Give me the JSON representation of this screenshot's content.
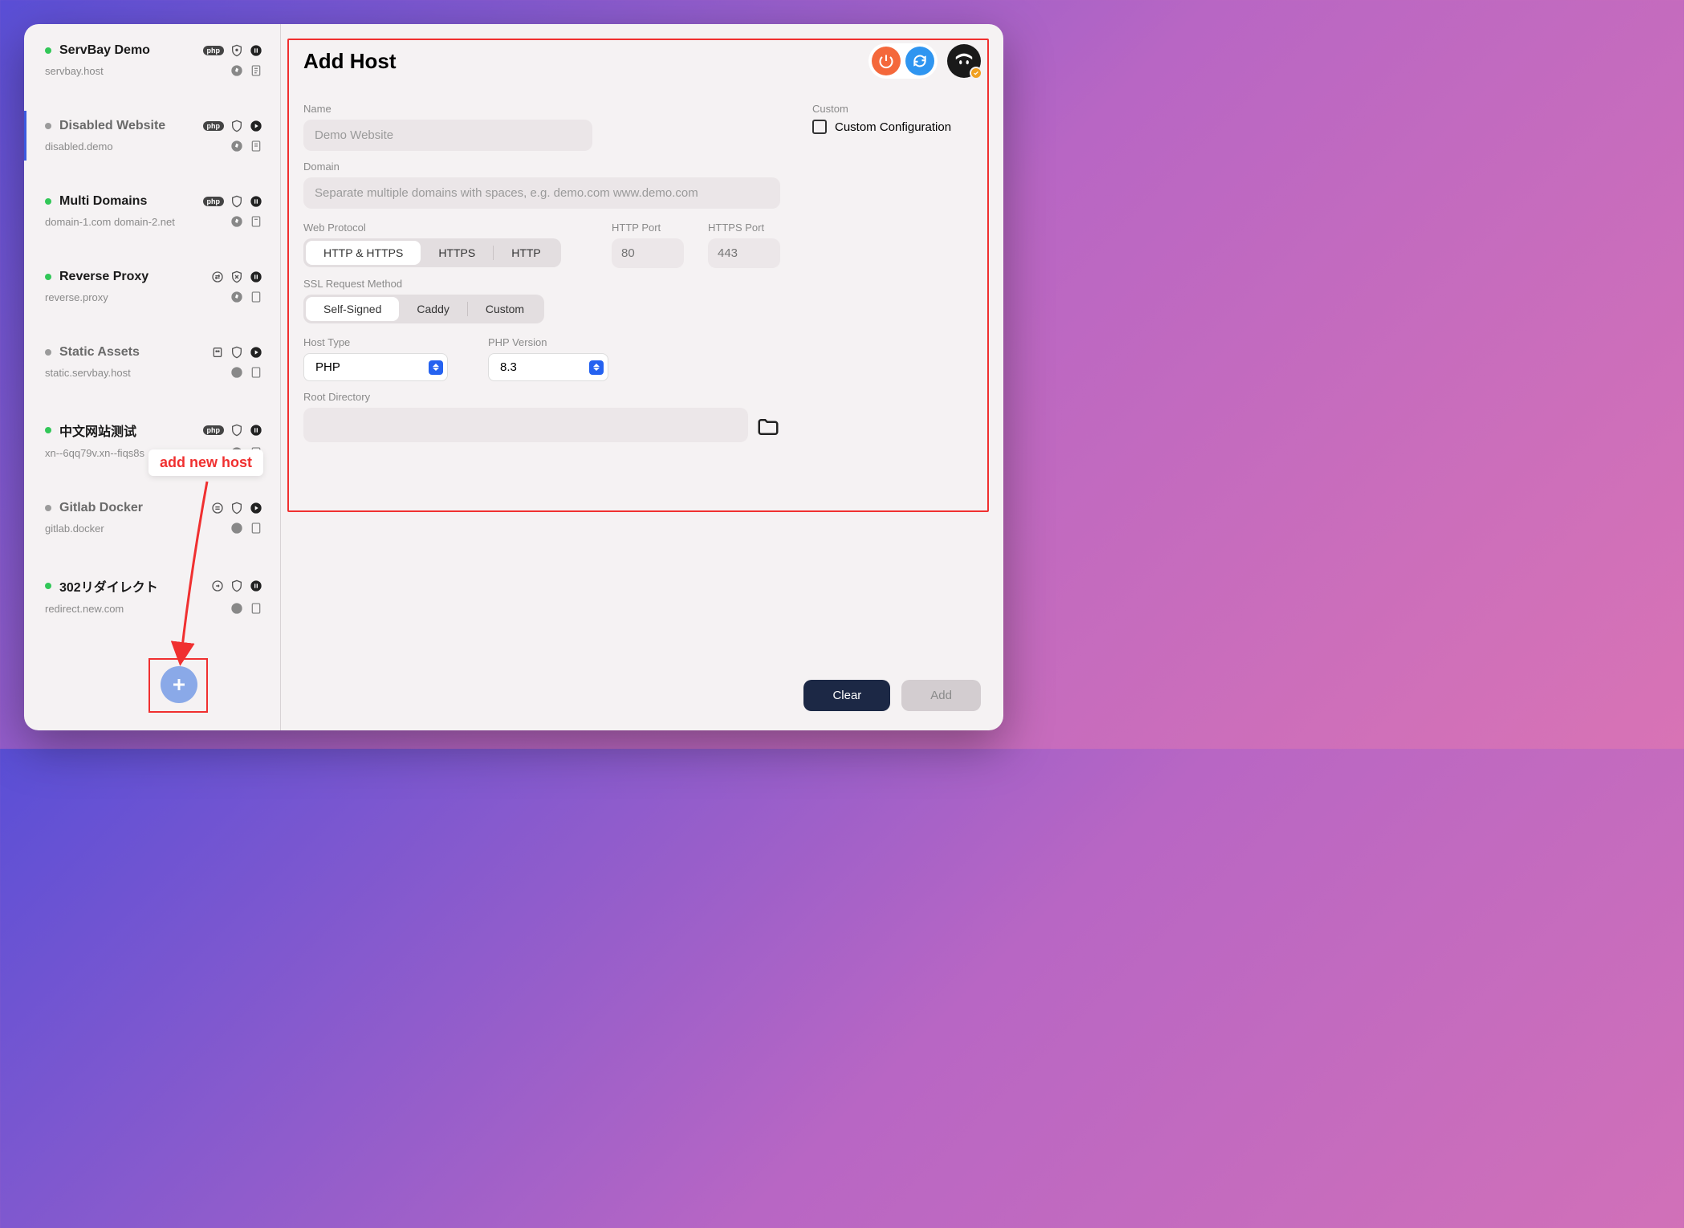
{
  "sidebar": {
    "sites": [
      {
        "name": "ServBay Demo",
        "domain": "servbay.host",
        "status": "green",
        "badge": "php",
        "icon1": "shield-lock",
        "icon2": "pause",
        "icon3": "compass",
        "icon4": "log"
      },
      {
        "name": "Disabled Website",
        "domain": "disabled.demo",
        "status": "grey",
        "badge": "php",
        "icon1": "shield",
        "icon2": "play",
        "icon3": "compass",
        "icon4": "log",
        "selected": true
      },
      {
        "name": "Multi Domains",
        "domain": "domain-1.com domain-2.net",
        "status": "green",
        "badge": "php",
        "icon1": "shield",
        "icon2": "pause",
        "icon3": "compass",
        "icon4": "log"
      },
      {
        "name": "Reverse Proxy",
        "domain": "reverse.proxy",
        "status": "green",
        "badge": "swap",
        "icon1": "shield-x",
        "icon2": "pause",
        "icon3": "compass",
        "icon4": "log"
      },
      {
        "name": "Static Assets",
        "domain": "static.servbay.host",
        "status": "grey",
        "badge": "static",
        "icon1": "shield",
        "icon2": "play",
        "icon3": "compass",
        "icon4": "log"
      },
      {
        "name": "中文网站测试",
        "domain": "xn--6qq79v.xn--fiqs8s",
        "status": "green",
        "badge": "php",
        "icon1": "shield",
        "icon2": "pause",
        "icon3": "compass",
        "icon4": "log"
      },
      {
        "name": "Gitlab Docker",
        "domain": "gitlab.docker",
        "status": "grey",
        "badge": "swap",
        "icon1": "shield",
        "icon2": "play",
        "icon3": "compass",
        "icon4": "log"
      },
      {
        "name": "302リダイレクト",
        "domain": "redirect.new.com",
        "status": "green",
        "badge": "redirect",
        "icon1": "shield",
        "icon2": "pause",
        "icon3": "compass",
        "icon4": "log"
      }
    ]
  },
  "annotation": {
    "tooltip": "add new host"
  },
  "main": {
    "title": "Add Host",
    "labels": {
      "name": "Name",
      "domain": "Domain",
      "web_protocol": "Web Protocol",
      "ssl": "SSL Request Method",
      "host_type": "Host Type",
      "php_version": "PHP Version",
      "root_dir": "Root Directory",
      "custom": "Custom",
      "custom_config": "Custom Configuration",
      "http_port": "HTTP Port",
      "https_port": "HTTPS Port"
    },
    "placeholders": {
      "name": "Demo Website",
      "domain": "Separate multiple domains with spaces, e.g. demo.com www.demo.com",
      "http_port": "80",
      "https_port": "443"
    },
    "web_protocol": {
      "options": [
        "HTTP & HTTPS",
        "HTTPS",
        "HTTP"
      ],
      "selected": 0
    },
    "ssl_method": {
      "options": [
        "Self-Signed",
        "Caddy",
        "Custom"
      ],
      "selected": 0
    },
    "host_type": {
      "value": "PHP"
    },
    "php_version": {
      "value": "8.3"
    },
    "buttons": {
      "clear": "Clear",
      "add": "Add"
    }
  }
}
